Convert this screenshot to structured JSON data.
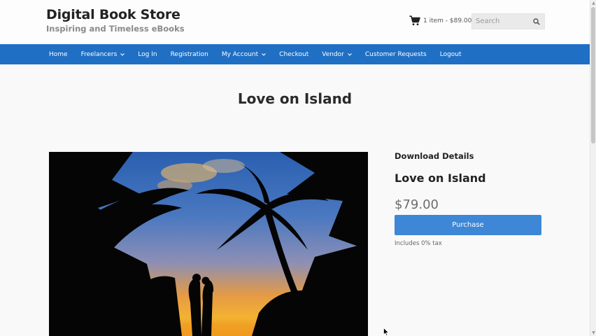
{
  "header": {
    "site_title": "Digital Book Store",
    "tagline": "Inspiring and Timeless eBooks",
    "cart_text": "1 item - $89.00",
    "cart_icon": "cart-icon",
    "search_placeholder": "Search",
    "search_icon": "search-icon"
  },
  "nav": {
    "items": [
      {
        "label": "Home"
      },
      {
        "label": "Freelancers"
      },
      {
        "label": "Log In"
      },
      {
        "label": "Registration"
      },
      {
        "label": "My Account"
      },
      {
        "label": "Checkout"
      },
      {
        "label": "Vendor"
      },
      {
        "label": "Customer Requests"
      },
      {
        "label": "Logout"
      }
    ]
  },
  "main": {
    "page_title": "Love on Island",
    "details_heading": "Download Details",
    "product_name": "Love on Island",
    "price": "$79.00",
    "purchase_label": "Purchase",
    "tax_note": "Includes 0% tax"
  },
  "colors": {
    "nav_bg": "#1f6fc5",
    "button_bg": "#3d87d6",
    "page_bg": "#f9f9f9"
  }
}
